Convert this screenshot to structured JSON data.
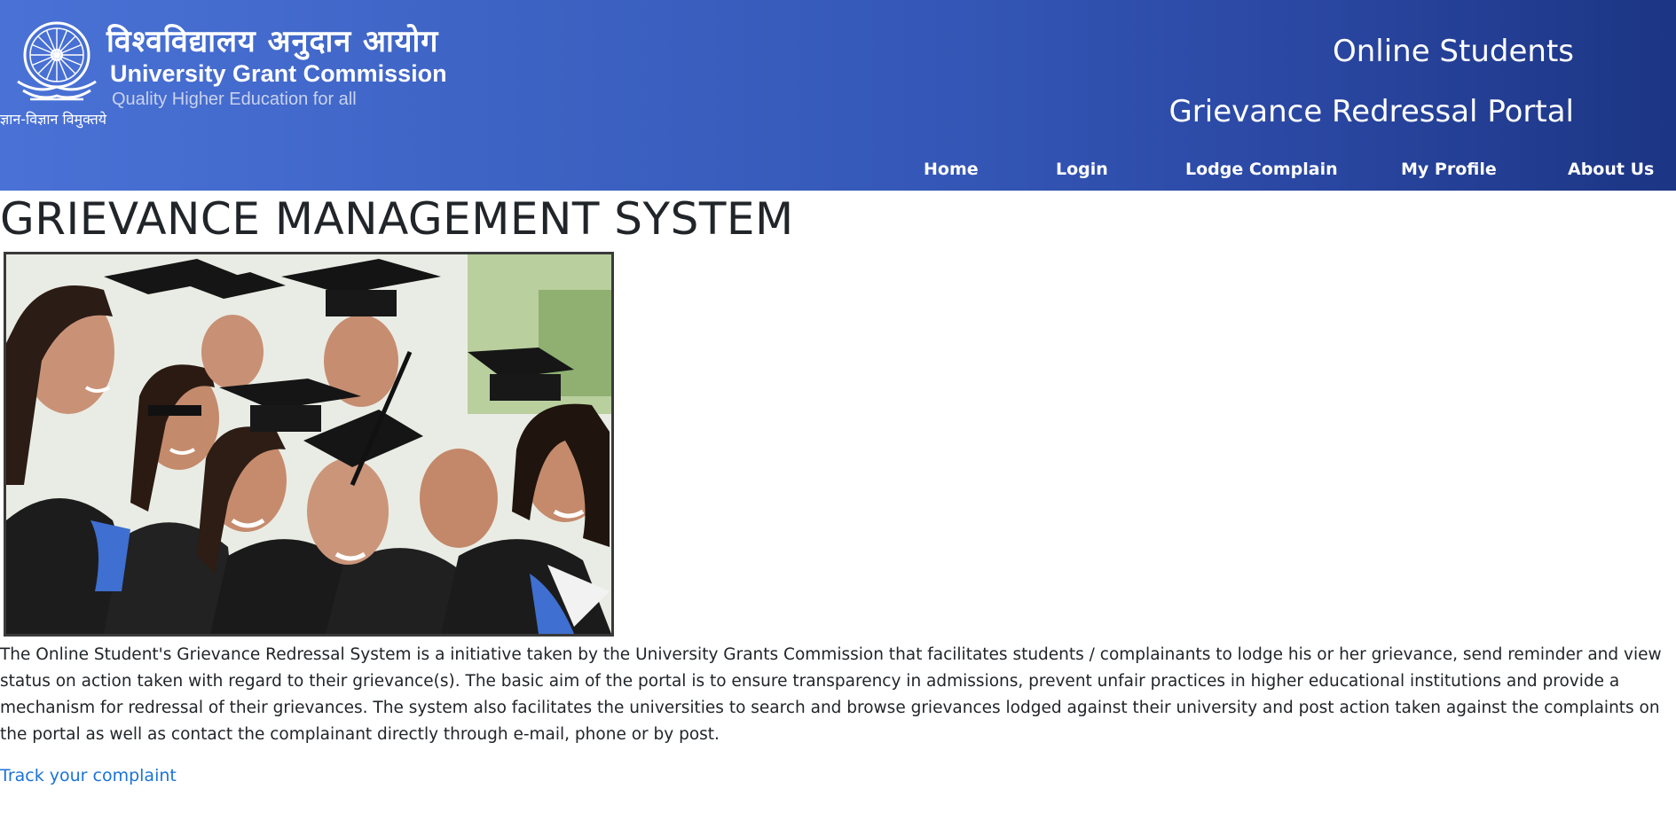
{
  "header": {
    "hindi_title": "विश्वविद्यालय अनुदान आयोग",
    "ugc_name": "University Grant Commission",
    "tagline": "Quality Higher Education for all",
    "hindi_motto": "ज्ञान-विज्ञान विमुक्तये",
    "portal_line1": "Online Students",
    "portal_line2": "Grievance Redressal Portal",
    "emblem_icon": "ashoka-chakra-emblem"
  },
  "nav": {
    "items": [
      {
        "label": "Home"
      },
      {
        "label": "Login"
      },
      {
        "label": "Lodge Complain"
      },
      {
        "label": "My Profile"
      },
      {
        "label": "About Us"
      }
    ]
  },
  "main": {
    "title": "GRIEVANCE MANAGEMENT SYSTEM",
    "description": "The Online Student's Grievance Redressal System is a initiative taken by the University Grants Commission that facilitates students / complainants to lodge his or her grievance, send reminder and view status on action taken with regard to their grievance(s). The basic aim of the portal is to ensure transparency in admissions, prevent unfair practices in higher educational institutions and provide a mechanism for redressal of their grievances. The system also facilitates the universities to search and browse grievances lodged against their university and post action taken against the complaints on the portal as well as contact the complainant directly through e-mail, phone or by post.",
    "track_link": "Track your complaint"
  },
  "colors": {
    "header_start": "#4a72d6",
    "header_end": "#1c3584",
    "link": "#1a73d6",
    "text": "#212529"
  }
}
